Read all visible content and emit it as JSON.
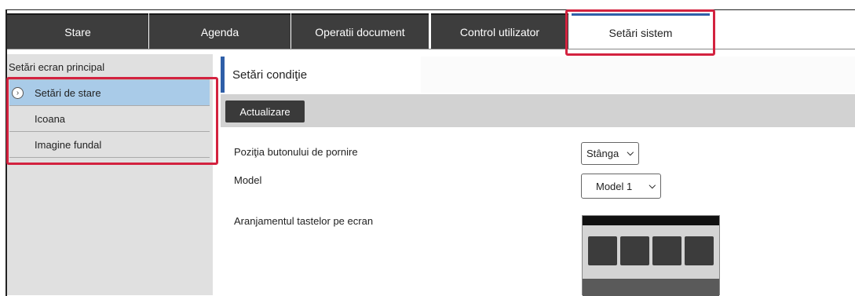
{
  "tabs": [
    {
      "label": "Stare"
    },
    {
      "label": "Agenda"
    },
    {
      "label": "Operatii document"
    },
    {
      "label": "Control utilizator"
    },
    {
      "label": "Setări sistem"
    }
  ],
  "sidebar": {
    "header": "Setări ecran principal",
    "items": [
      {
        "label": "Setări de stare",
        "icon": "chevron-right-circle-icon"
      },
      {
        "label": "Icoana"
      },
      {
        "label": "Imagine fundal"
      }
    ]
  },
  "main": {
    "title": "Setări condiţie",
    "update_label": "Actualizare",
    "rows": [
      {
        "label": "Poziţia butonului de pornire",
        "value": "Stânga"
      },
      {
        "label": "Model",
        "value": "Model 1"
      },
      {
        "label": "Aranjamentul tastelor pe ecran"
      }
    ]
  },
  "colors": {
    "highlight": "#d3223f",
    "accent": "#2f5fa8",
    "selected": "#a9cbe8"
  }
}
